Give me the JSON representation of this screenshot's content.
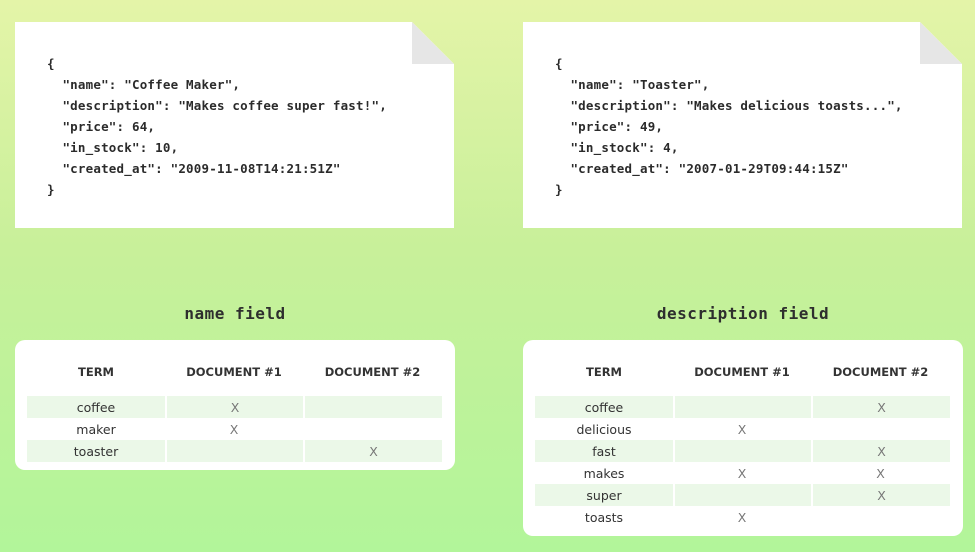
{
  "documents": [
    {
      "lines": [
        "{",
        "  \"name\": \"Coffee Maker\",",
        "  \"description\": \"Makes coffee super fast!\",",
        "  \"price\": 64,",
        "  \"in_stock\": 10,",
        "  \"created_at\": \"2009-11-08T14:21:51Z\"",
        "}"
      ]
    },
    {
      "lines": [
        "{",
        "  \"name\": \"Toaster\",",
        "  \"description\": \"Makes delicious toasts...\",",
        "  \"price\": 49,",
        "  \"in_stock\": 4,",
        "  \"created_at\": \"2007-01-29T09:44:15Z\"",
        "}"
      ]
    }
  ],
  "indexes": [
    {
      "title": "name field",
      "headers": [
        "TERM",
        "DOCUMENT #1",
        "DOCUMENT #2"
      ],
      "rows": [
        [
          "coffee",
          "X",
          ""
        ],
        [
          "maker",
          "X",
          ""
        ],
        [
          "toaster",
          "",
          "X"
        ]
      ]
    },
    {
      "title": "description field",
      "headers": [
        "TERM",
        "DOCUMENT #1",
        "DOCUMENT #2"
      ],
      "rows": [
        [
          "coffee",
          "",
          "X"
        ],
        [
          "delicious",
          "X",
          ""
        ],
        [
          "fast",
          "",
          "X"
        ],
        [
          "makes",
          "X",
          "X"
        ],
        [
          "super",
          "",
          "X"
        ],
        [
          "toasts",
          "X",
          ""
        ]
      ]
    }
  ]
}
